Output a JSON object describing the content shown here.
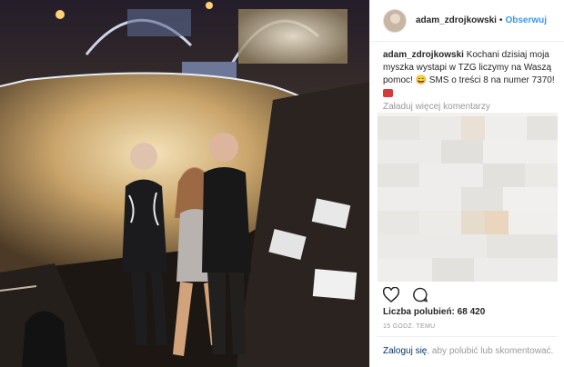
{
  "post": {
    "username": "adam_zdrojkowski",
    "separator": "•",
    "follow_label": "Obserwuj",
    "caption_text": "Kochani dzisiaj moja myszka wystapi w TZG liczymy na Waszą pomoc! 😄 SMS o treści 8 na numer 7370!",
    "load_more": "Załaduj więcej komentarzy",
    "likes_label": "Liczba polubień: 68 420",
    "timestamp": "15 GODZ. TEMU",
    "login_link": "Zaloguj się",
    "login_rest": ", aby polubić lub skomentować."
  },
  "icons": {
    "like": "heart-outline-icon",
    "comment": "comment-bubble-icon",
    "emoji": "heart-emoji"
  },
  "colors": {
    "link": "#3897f0",
    "text": "#262626",
    "muted": "#999999",
    "login_link": "#003569"
  }
}
